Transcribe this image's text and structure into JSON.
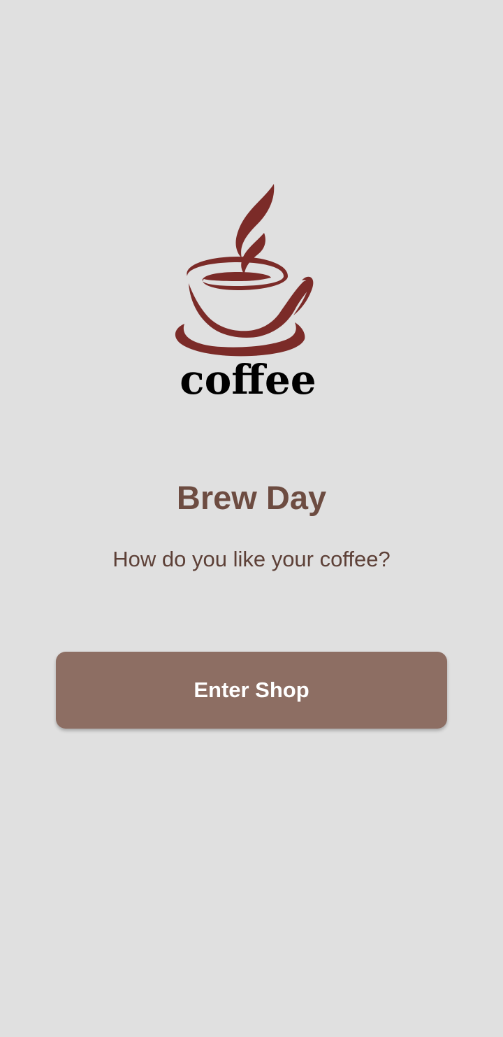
{
  "logo": {
    "icon": "coffee-cup-icon",
    "wordmark": "coffee",
    "cup_color": "#7b2b28",
    "wordmark_color": "#000000"
  },
  "main": {
    "title": "Brew Day",
    "subtitle": "How do you like your coffee?",
    "enter_button_label": "Enter Shop"
  },
  "colors": {
    "background": "#e0e0e0",
    "title": "#6d4c41",
    "subtitle": "#5d4037",
    "button": "#8d6e63",
    "button_text": "#ffffff"
  }
}
